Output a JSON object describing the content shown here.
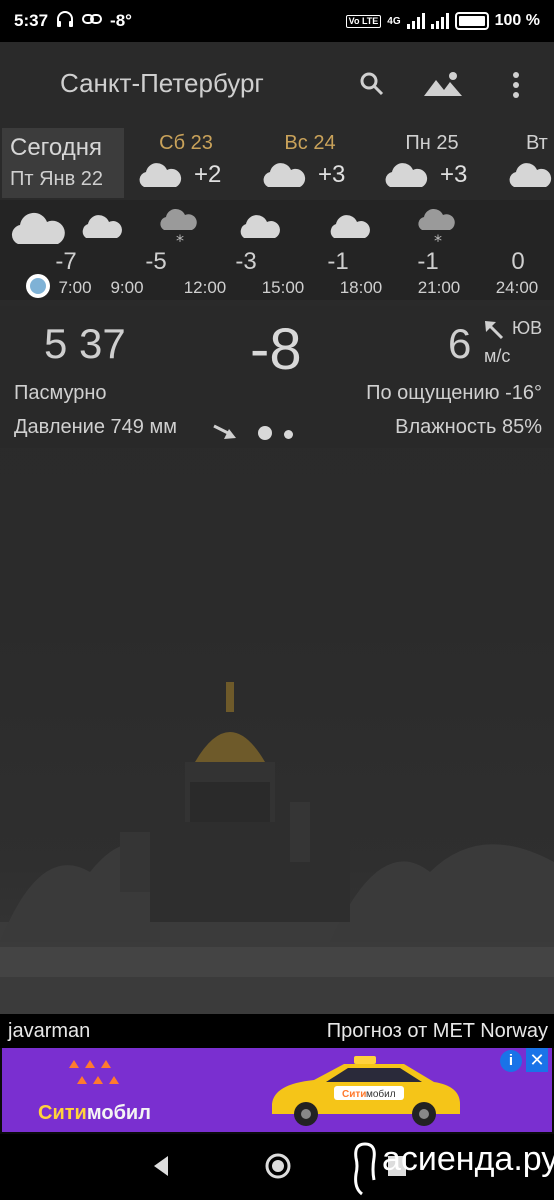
{
  "status_bar": {
    "time": "5:37",
    "temp": "-8°",
    "network": "4G",
    "volte": "Vo LTE",
    "battery": "100 %"
  },
  "toolbar": {
    "city": "Санкт-Петербург",
    "icons": [
      "search-icon",
      "landscape-icon",
      "more-vert-icon"
    ]
  },
  "days": {
    "today": {
      "label": "Сегодня",
      "date": "Пт Янв 22"
    },
    "items": [
      {
        "name": "Сб 23",
        "temp": "+2",
        "color": "#c9a25a"
      },
      {
        "name": "Вс 24",
        "temp": "+3",
        "color": "#c9a25a"
      },
      {
        "name": "Пн 25",
        "temp": "+3",
        "color": "#d0d0d0"
      },
      {
        "name": "Вт",
        "temp": "",
        "color": "#d0d0d0"
      }
    ]
  },
  "hourly": {
    "temps": [
      "-7",
      "-5",
      "-3",
      "-1",
      "-1",
      "0"
    ],
    "times": [
      "7:00",
      "9:00",
      "12:00",
      "15:00",
      "18:00",
      "21:00",
      "24:00"
    ],
    "icons": [
      "cloud-icon",
      "cloud-icon",
      "snow-cloud-icon",
      "cloud-icon",
      "cloud-icon",
      "snow-cloud-icon"
    ]
  },
  "current": {
    "clock": "5 37",
    "temp": "-8",
    "wind_speed": "6",
    "wind_dir": "ЮВ",
    "wind_unit": "м/с",
    "condition": "Пасмурно",
    "feels_like": "По ощущению -16°",
    "pressure": "Давление 749 мм",
    "humidity": "Влажность 85%"
  },
  "credits": {
    "author": "javarman",
    "source": "Прогноз от MET Norway"
  },
  "ad": {
    "brand_a": "Сити",
    "brand_b": "мобил",
    "info": "i",
    "close": "✕"
  },
  "watermark": "асиенда.ру"
}
